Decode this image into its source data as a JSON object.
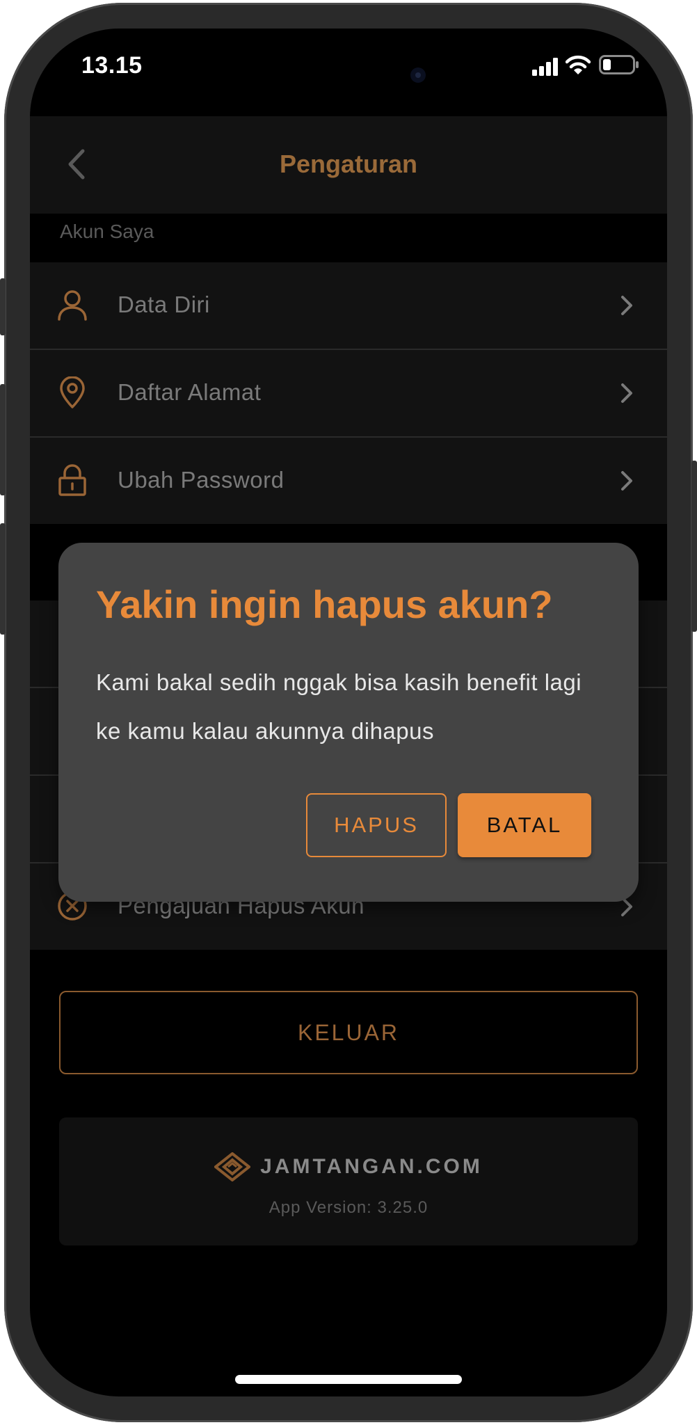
{
  "status_bar": {
    "time": "13.15"
  },
  "header": {
    "title": "Pengaturan"
  },
  "section": {
    "label": "Akun Saya"
  },
  "menu": {
    "items": [
      {
        "label": "Data Diri",
        "icon": "user-icon"
      },
      {
        "label": "Daftar Alamat",
        "icon": "location-pin-icon"
      },
      {
        "label": "Ubah Password",
        "icon": "lock-icon"
      },
      {
        "label": "Pengajuan Hapus Akun",
        "icon": "circle-x-icon"
      }
    ]
  },
  "logout": {
    "label": "KELUAR"
  },
  "footer": {
    "brand": "JAMTANGAN.COM",
    "version": "App Version: 3.25.0"
  },
  "dialog": {
    "title": "Yakin ingin hapus akun?",
    "body": "Kami bakal sedih nggak bisa kasih benefit lagi ke kamu kalau akunnya dihapus",
    "delete_label": "HAPUS",
    "cancel_label": "BATAL"
  },
  "colors": {
    "accent": "#e88a3a",
    "accent_dim": "#9a6a39",
    "background": "#000000",
    "surface": "#121212",
    "dialog": "#444444"
  }
}
